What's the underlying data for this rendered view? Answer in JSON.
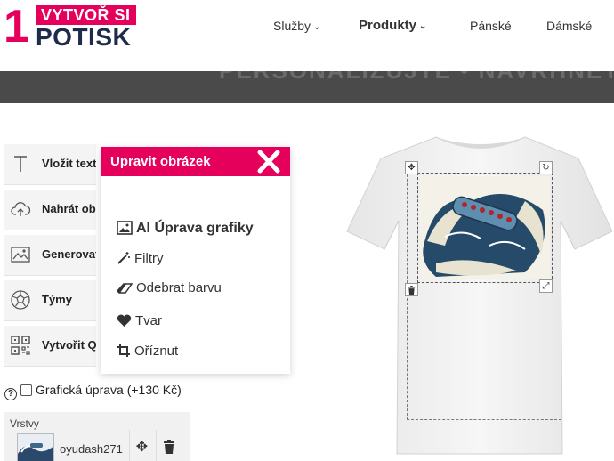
{
  "logo": {
    "number": "1",
    "top": "VYTVOŘ SI",
    "bottom": "POTISK"
  },
  "nav": [
    {
      "label": "Služby",
      "bold": false
    },
    {
      "label": "Produkty",
      "bold": true
    },
    {
      "label": "Pánské",
      "bold": false
    },
    {
      "label": "Dámské",
      "bold": false
    }
  ],
  "banner_text": "PERSONALIZUJTE • NAVRHNĚTE VLASTNÍ",
  "tools": [
    {
      "label": "Vložit text",
      "icon": "text-icon"
    },
    {
      "label": "Nahrát obrázek",
      "icon": "cloud-upload-icon"
    },
    {
      "label": "Generovat",
      "icon": "image-icon"
    },
    {
      "label": "Týmy",
      "icon": "football-icon"
    },
    {
      "label": "Vytvořit QR",
      "icon": "qr-icon"
    }
  ],
  "graphic_edit": {
    "label": "Grafická úprava (+130 Kč)",
    "checked": false
  },
  "layers": {
    "title": "Vrstvy",
    "items": [
      {
        "name": "oyudash271"
      }
    ]
  },
  "popup": {
    "title": "Upravit obrázek",
    "items": [
      {
        "label": "AI Úprava grafiky",
        "icon": "image-icon",
        "strong": true
      },
      {
        "label": "Filtry",
        "icon": "magic-wand-icon",
        "strong": false
      },
      {
        "label": "Odebrat barvu",
        "icon": "eraser-icon",
        "strong": false
      },
      {
        "label": "Tvar",
        "icon": "heart-icon",
        "strong": false
      },
      {
        "label": "Oříznut",
        "icon": "crop-icon",
        "strong": false
      }
    ]
  },
  "colors": {
    "accent": "#e5005b",
    "brand_dark": "#1f2b4a",
    "banner": "#4a4a4a"
  }
}
